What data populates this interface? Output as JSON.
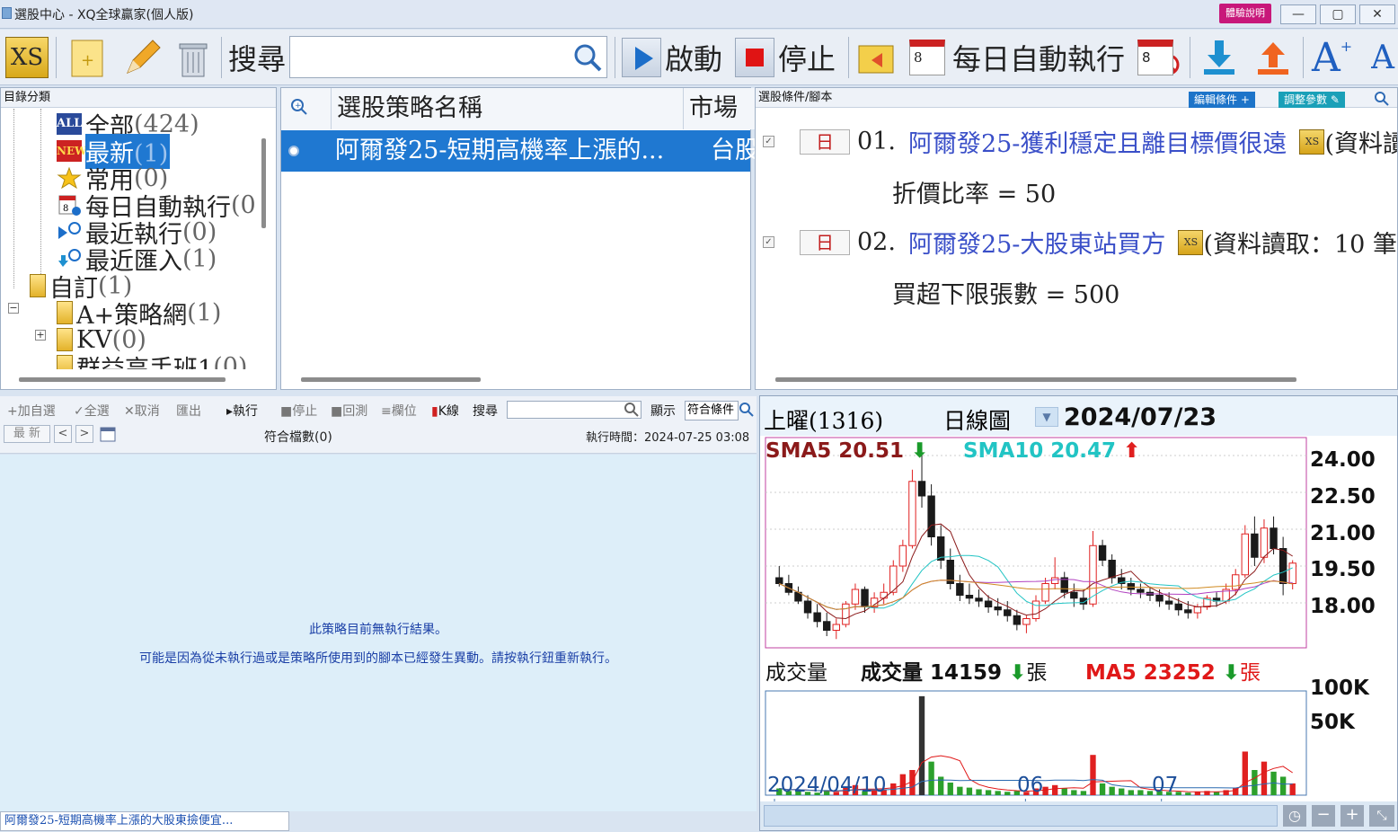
{
  "window": {
    "title": "選股中心 - XQ全球贏家(個人版)",
    "help_button": "體驗說明",
    "controls": [
      "—",
      "▢",
      "✕"
    ]
  },
  "toolbar": {
    "xs_label": "XS",
    "search_label": "搜尋",
    "search_value": "",
    "start_label": "啟動",
    "stop_label": "停止",
    "daily_run_label": "每日自動執行",
    "calendar_day": "8"
  },
  "catalog": {
    "header": "目錄分類",
    "items": [
      {
        "icon": "ALL",
        "label": "全部",
        "count": "(424)"
      },
      {
        "icon": "NEW",
        "label": "最新",
        "count": "(1)"
      },
      {
        "icon": "star-icon",
        "label": "常用",
        "count": "(0)"
      },
      {
        "icon": "calendar-icon",
        "label": "每日自動執行",
        "count": "(0"
      },
      {
        "icon": "recent-run-icon",
        "label": "最近執行",
        "count": "(0)"
      },
      {
        "icon": "recent-import-icon",
        "label": "最近匯入",
        "count": "(1)"
      },
      {
        "icon": "folder-icon",
        "label": "自訂",
        "count": "(1)"
      },
      {
        "icon": "folder-icon",
        "label": "A+策略網",
        "count": "(1)"
      },
      {
        "icon": "folder-icon",
        "label": "KV",
        "count": "(0)"
      },
      {
        "icon": "folder-icon",
        "label": "群益高手班1",
        "count": "(0)"
      }
    ]
  },
  "strategy_list": {
    "columns": [
      "選股策略名稱",
      "市場"
    ],
    "rows": [
      {
        "name": "阿爾發25-短期高機率上漲的...",
        "market": "台股"
      }
    ]
  },
  "conditions": {
    "header": "選股條件/腳本",
    "edit_button": "編輯條件",
    "adjust_button": "調整參數",
    "items": [
      {
        "period": "日",
        "index": "01.",
        "name": "阿爾發25-獲利穩定且離目標價很遠",
        "suffix": "(資料讀",
        "param": "折價比率 = 50"
      },
      {
        "period": "日",
        "index": "02.",
        "name": "阿爾發25-大股東站買方",
        "suffix": "(資料讀取：10 筆)",
        "param": "買超下限張數 = 500"
      }
    ]
  },
  "results": {
    "toolbar": [
      "+加自選",
      "✓全選",
      "✕取消",
      "匯出",
      "執行",
      "停止",
      "回測",
      "欄位",
      "K線",
      "搜尋"
    ],
    "display_label": "顯示",
    "display_value": "符合條件",
    "latest_button": "最 新",
    "count_label": "符合檔數(0)",
    "exec_time": "執行時間：2024-07-25 03:08",
    "empty_line1": "此策略目前無執行結果。",
    "empty_line2": "可能是因為從未執行過或是策略所使用到的腳本已經發生異動。請按執行鈕重新執行。",
    "bottom_tab": "阿爾發25-短期高機率上漲的大股東撿便宜..."
  },
  "chart": {
    "symbol": "上曜(1316)",
    "period": "日線圖",
    "date": "2024/07/23",
    "sma5_label": "SMA5 20.51",
    "sma10_label": "SMA10 20.47",
    "y_ticks": [
      "24.00",
      "22.50",
      "21.00",
      "19.50",
      "18.00"
    ],
    "volume_title": "成交量",
    "volume_label": "成交量 14159",
    "volume_unit": "張",
    "ma5_label": "MA5 23252",
    "ma5_unit": "張",
    "vol_ticks": [
      "100K",
      "50K"
    ],
    "x_ticks": [
      "2024/04/10",
      "06",
      "07"
    ],
    "colors": {
      "up": "#e02020",
      "down": "#1a1a1a",
      "vol_up": "#2ca02c",
      "sma5": "#8b1a1a",
      "sma10": "#22c4c4"
    }
  },
  "chart_data": {
    "type": "candlestick",
    "title": "上曜(1316)",
    "ylim": [
      17.4,
      24.6
    ],
    "candles": [
      [
        19.8,
        20.2,
        19.5,
        19.6
      ],
      [
        19.6,
        19.9,
        19.2,
        19.3
      ],
      [
        19.3,
        19.5,
        18.9,
        19.0
      ],
      [
        19.0,
        19.2,
        18.4,
        18.6
      ],
      [
        18.6,
        18.9,
        18.1,
        18.3
      ],
      [
        18.3,
        18.6,
        17.8,
        18.0
      ],
      [
        18.0,
        18.4,
        17.7,
        18.2
      ],
      [
        18.2,
        19.0,
        18.1,
        18.9
      ],
      [
        18.9,
        19.6,
        18.7,
        19.4
      ],
      [
        19.4,
        19.5,
        18.6,
        18.8
      ],
      [
        18.8,
        19.3,
        18.6,
        19.1
      ],
      [
        19.1,
        19.6,
        18.9,
        19.3
      ],
      [
        19.3,
        20.4,
        19.2,
        20.2
      ],
      [
        20.2,
        21.1,
        20.0,
        20.9
      ],
      [
        20.9,
        23.5,
        20.8,
        23.1
      ],
      [
        23.1,
        24.2,
        22.2,
        22.6
      ],
      [
        22.6,
        23.0,
        20.9,
        21.2
      ],
      [
        21.2,
        21.6,
        20.1,
        20.4
      ],
      [
        20.4,
        20.8,
        19.4,
        19.6
      ],
      [
        19.6,
        19.9,
        19.0,
        19.2
      ],
      [
        19.2,
        19.6,
        18.9,
        19.1
      ],
      [
        19.1,
        19.4,
        18.8,
        19.0
      ],
      [
        19.0,
        19.2,
        18.6,
        18.8
      ],
      [
        18.8,
        19.1,
        18.5,
        18.7
      ],
      [
        18.7,
        19.0,
        18.3,
        18.5
      ],
      [
        18.5,
        18.7,
        18.0,
        18.2
      ],
      [
        18.2,
        18.5,
        17.9,
        18.4
      ],
      [
        18.4,
        19.2,
        18.3,
        19.0
      ],
      [
        19.0,
        19.8,
        18.9,
        19.6
      ],
      [
        19.6,
        20.5,
        19.4,
        19.8
      ],
      [
        19.8,
        20.0,
        19.1,
        19.3
      ],
      [
        19.3,
        19.6,
        18.8,
        19.1
      ],
      [
        19.1,
        19.4,
        18.7,
        18.9
      ],
      [
        18.9,
        21.4,
        18.8,
        20.9
      ],
      [
        20.9,
        21.1,
        20.2,
        20.4
      ],
      [
        20.4,
        20.6,
        19.6,
        19.8
      ],
      [
        19.8,
        20.1,
        19.4,
        19.6
      ],
      [
        19.6,
        19.8,
        19.2,
        19.4
      ],
      [
        19.4,
        19.6,
        19.1,
        19.3
      ],
      [
        19.3,
        19.5,
        19.0,
        19.2
      ],
      [
        19.2,
        19.4,
        18.8,
        19.0
      ],
      [
        19.0,
        19.3,
        18.7,
        18.9
      ],
      [
        18.9,
        19.1,
        18.5,
        18.7
      ],
      [
        18.7,
        19.0,
        18.4,
        18.6
      ],
      [
        18.6,
        18.9,
        18.4,
        18.8
      ],
      [
        18.8,
        19.2,
        18.7,
        19.1
      ],
      [
        19.1,
        19.3,
        18.8,
        19.0
      ],
      [
        19.0,
        19.6,
        18.9,
        19.4
      ],
      [
        19.4,
        20.1,
        19.2,
        19.9
      ],
      [
        19.9,
        21.6,
        19.8,
        21.3
      ],
      [
        21.3,
        21.9,
        20.2,
        20.5
      ],
      [
        20.5,
        21.8,
        20.3,
        21.5
      ],
      [
        21.5,
        21.9,
        20.6,
        20.8
      ],
      [
        20.8,
        21.2,
        19.2,
        19.6
      ],
      [
        19.6,
        20.4,
        19.4,
        20.3
      ]
    ],
    "volume_ylim": [
      0,
      120000
    ],
    "volume": [
      8000,
      5000,
      7000,
      4000,
      3000,
      6000,
      4000,
      9000,
      12000,
      5000,
      6000,
      7000,
      14000,
      25000,
      30000,
      118000,
      40000,
      22000,
      15000,
      10000,
      9000,
      7000,
      6000,
      5000,
      4000,
      5000,
      4000,
      8000,
      10000,
      12000,
      8000,
      6000,
      5000,
      48000,
      14000,
      10000,
      8000,
      6000,
      6000,
      5000,
      5000,
      4000,
      4000,
      3000,
      4000,
      5000,
      4000,
      6000,
      9000,
      52000,
      30000,
      40000,
      28000,
      22000,
      14000
    ]
  }
}
